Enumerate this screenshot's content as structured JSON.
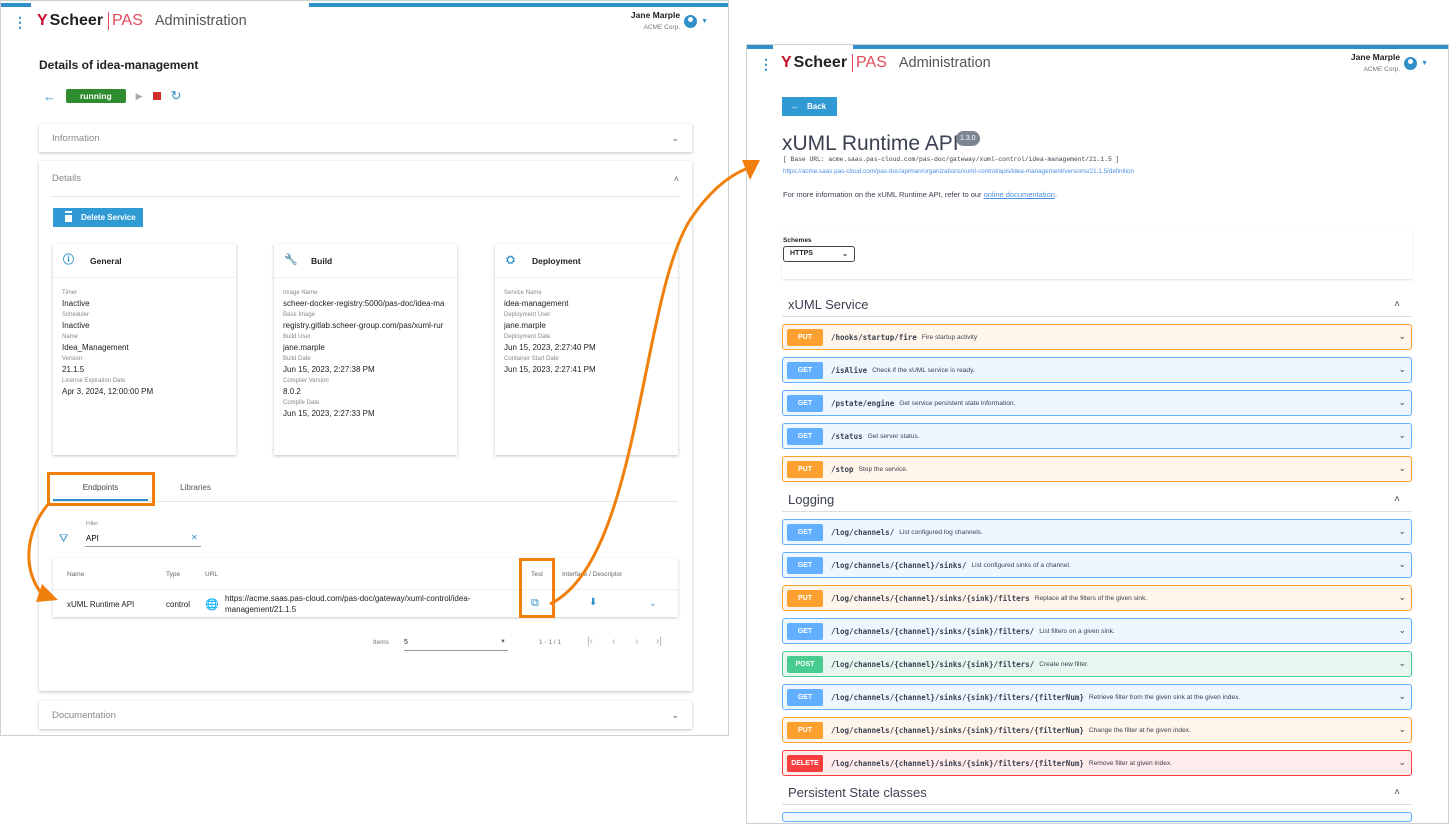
{
  "colors": {
    "accent": "#2f8fc8",
    "running": "#2e8b2e",
    "stop": "#d32f2f",
    "highlight": "#f07f0c",
    "put": "#fca130",
    "get": "#61affe",
    "post": "#49cc90",
    "delete": "#f93e3e"
  },
  "app": {
    "logo_mark": "Y",
    "logo_brand": "Scheer",
    "logo_product": "PAS",
    "title": "Administration",
    "user_name": "Jane Marple",
    "user_org": "ACME Corp."
  },
  "left": {
    "page_title": "Details of idea-management",
    "status": "running",
    "panels": {
      "information": "Information",
      "details": "Details",
      "documentation": "Documentation"
    },
    "delete_button": "Delete Service",
    "cards": [
      {
        "title": "General",
        "icon": "info-icon",
        "fields": [
          {
            "label": "Timer",
            "value": "Inactive"
          },
          {
            "label": "Scheduler",
            "value": "Inactive"
          },
          {
            "label": "Name",
            "value": "Idea_Management"
          },
          {
            "label": "Version",
            "value": "21.1.5"
          },
          {
            "label": "License Expiration Date",
            "value": "Apr 3, 2024, 12:00:00 PM"
          }
        ]
      },
      {
        "title": "Build",
        "icon": "wrench-icon",
        "fields": [
          {
            "label": "Image Name",
            "value": "scheer-docker-registry:5000/pas-doc/idea-ma"
          },
          {
            "label": "Base Image",
            "value": "registry.gitlab.scheer-group.com/pas/xuml-rur"
          },
          {
            "label": "Build User",
            "value": "jane.marple"
          },
          {
            "label": "Build Date",
            "value": "Jun 15, 2023, 2:27:38 PM"
          },
          {
            "label": "Compiler Version",
            "value": "8.0.2"
          },
          {
            "label": "Compile Date",
            "value": "Jun 15, 2023, 2:27:33 PM"
          }
        ]
      },
      {
        "title": "Deployment",
        "icon": "deployment-icon",
        "fields": [
          {
            "label": "Service Name",
            "value": "idea-management"
          },
          {
            "label": "Deployment User",
            "value": "jane.marple"
          },
          {
            "label": "Deployment Date",
            "value": "Jun 15, 2023, 2:27:40 PM"
          },
          {
            "label": "Container Start Date",
            "value": "Jun 15, 2023, 2:27:41 PM"
          }
        ]
      }
    ],
    "tabs": [
      "Endpoints",
      "Libraries"
    ],
    "filter": {
      "label": "Filter",
      "value": "API"
    },
    "table": {
      "headers": [
        "Name",
        "Type",
        "URL",
        "Test",
        "Interface / Descriptor"
      ],
      "row": {
        "name": "xUML Runtime API",
        "type": "control",
        "url_line1": "https://acme.saas.pas-cloud.com/pas-doc/gateway/xuml-control/idea-",
        "url_line2": "management/21.1.5"
      }
    },
    "pager": {
      "items_label": "Items",
      "items_value": "5",
      "range": "1 - 1 / 1"
    }
  },
  "right": {
    "back_button": "Back",
    "api_title": "xUML Runtime API",
    "version": "1.3.0",
    "base_url": "[ Base URL: acme.saas.pas-cloud.com/pas-doc/gateway/xuml-control/idea-management/21.1.5 ]",
    "definition_link": "https://acme.saas.pas-cloud.com/pas-doc/apiman/organizations/xuml-control/apis/idea-management/versions/21.1.5/definition",
    "info_text": "For more information on the xUML Runtime API, refer to our ",
    "info_link": "online documentation",
    "info_end": ".",
    "schemes_label": "Schemes",
    "scheme": "HTTPS",
    "groups": [
      {
        "name": "xUML Service",
        "ops": [
          {
            "method": "PUT",
            "path": "/hooks/startup/fire",
            "desc": "Fire startup activity"
          },
          {
            "method": "GET",
            "path": "/isAlive",
            "desc": "Check if the xUML service is ready."
          },
          {
            "method": "GET",
            "path": "/pstate/engine",
            "desc": "Get service persistent state information."
          },
          {
            "method": "GET",
            "path": "/status",
            "desc": "Get server status."
          },
          {
            "method": "PUT",
            "path": "/stop",
            "desc": "Stop the service."
          }
        ]
      },
      {
        "name": "Logging",
        "ops": [
          {
            "method": "GET",
            "path": "/log/channels/",
            "desc": "List configured log channels."
          },
          {
            "method": "GET",
            "path": "/log/channels/{channel}/sinks/",
            "desc": "List configured sinks of a channel."
          },
          {
            "method": "PUT",
            "path": "/log/channels/{channel}/sinks/{sink}/filters",
            "desc": "Replace all the filters of the given sink."
          },
          {
            "method": "GET",
            "path": "/log/channels/{channel}/sinks/{sink}/filters/",
            "desc": "List filters on a given sink."
          },
          {
            "method": "POST",
            "path": "/log/channels/{channel}/sinks/{sink}/filters/",
            "desc": "Create new filter."
          },
          {
            "method": "GET",
            "path": "/log/channels/{channel}/sinks/{sink}/filters/{filterNum}",
            "desc": "Retrieve filter from the given sink at the given index."
          },
          {
            "method": "PUT",
            "path": "/log/channels/{channel}/sinks/{sink}/filters/{filterNum}",
            "desc": "Change the filter at he given index."
          },
          {
            "method": "DELETE",
            "path": "/log/channels/{channel}/sinks/{sink}/filters/{filterNum}",
            "desc": "Remove filter at given index."
          }
        ]
      },
      {
        "name": "Persistent State classes",
        "ops": []
      }
    ]
  }
}
